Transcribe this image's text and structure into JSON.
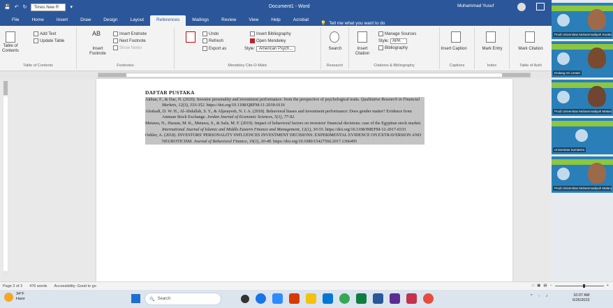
{
  "titlebar": {
    "font_name": "Times New R",
    "doc_title": "Document1 - Word",
    "user": "Muhammad Yusuf"
  },
  "tabs": [
    "File",
    "Home",
    "Insert",
    "Draw",
    "Design",
    "Layout",
    "References",
    "Mailings",
    "Review",
    "View",
    "Help",
    "Acrobat"
  ],
  "tell_me": "Tell me what you want to do",
  "ribbon": {
    "toc": {
      "big": "Table of Contents",
      "add_text": "Add Text",
      "update": "Update Table",
      "label": "Table of Contents"
    },
    "footnotes": {
      "insert": "Insert Footnote",
      "ab": "AB",
      "endnote": "Insert Endnote",
      "next": "Next Footnote",
      "show": "Show Notes",
      "label": "Footnotes"
    },
    "research": {
      "smart": "Smart Lookup",
      "researcher": "Researcher"
    },
    "citations": {
      "insert": "Insert Citation",
      "manage": "Manage Sources",
      "style_label": "Style:",
      "style_value": "APA",
      "bibliography": "Bibliography",
      "label": "Citations & Bibliography"
    },
    "mendeley": {
      "undo": "Undo",
      "refresh": "Refresh",
      "insert_bib": "Insert Bibliography",
      "open": "Open Mendeley",
      "export": "Export as",
      "style_label": "Style:",
      "style_value": "American Psych...",
      "label": "Mendeley Cite-O-Matic"
    },
    "research2": {
      "search": "Search",
      "label": "Research"
    },
    "captions": {
      "insert": "Insert Caption",
      "label": "Captions"
    },
    "index": {
      "mark": "Mark Entry",
      "label": "Index"
    },
    "toa": {
      "mark": "Mark Citation",
      "label": "Table of Auth"
    }
  },
  "document": {
    "heading": "DAFTAR PUSTAKA",
    "references": [
      {
        "pre": "Akhtar, F., & Das, N. (2020). Investor personality and investment performance: from the perspective of psychological traits. ",
        "journal": "Qualitative Research in Financial Markets, 12(3), 333-352.",
        "post": " https://doi.org/10.1108/QRFM-11-2018-0116"
      },
      {
        "pre": "Alrabadi, D. W. H., Al-Abdallah, S. Y., & Aljarayesh, N. I. A. (2018). Behavioral biases and investment performance: Does gender matter? Evidence from Amman Stock Exchange. ",
        "journal": "Jordan Journal of Economic Sciences, 5(1), 77-92.",
        "post": ""
      },
      {
        "pre": "Metawa, N., Hassan, M. K., Metawa, S., & Safa, M. F. (2019). Impact of behavioral factors on investors' financial decisions: case of the Egyptian stock market. ",
        "journal": "International Journal of Islamic and Middle Eastern Finance and Management, 12(1), 30-55.",
        "post": " https://doi.org/10.1108/IMEFM-12-2017-0333"
      },
      {
        "pre": "Oehler, A. (2018). INVESTORS' PERSONALITY INFLUENCES INVESTMENT DECISIONS: EXPERIMENTAL EVIDENCE ON EXTRAVERSION AND NEUROTICISM. ",
        "journal": "Journal of Behavioral Finance, 19(1), 30-48.",
        "post": " https://doi.org/10.1080/15427560.2017.1366495"
      }
    ]
  },
  "status": {
    "page": "Page 2 of 2",
    "words": "476 words",
    "accessibility": "Accessibility: Good to go"
  },
  "taskbar": {
    "temp": "34°F",
    "weather": "Haze",
    "search": "Search",
    "time": "10:07 AM",
    "date": "6/26/2023"
  },
  "participants": [
    "Prodi Universitas Muhammadiyah Surakarta",
    "Endang Sri Lestari",
    "Prodi Universitas Muhammadiyah Makassar",
    "Universitas Sumatera",
    "Prodi Universitas Muhammadiyah Malang"
  ],
  "colors": {
    "word_blue": "#2b579a",
    "highlight": "#c4c4c4"
  }
}
